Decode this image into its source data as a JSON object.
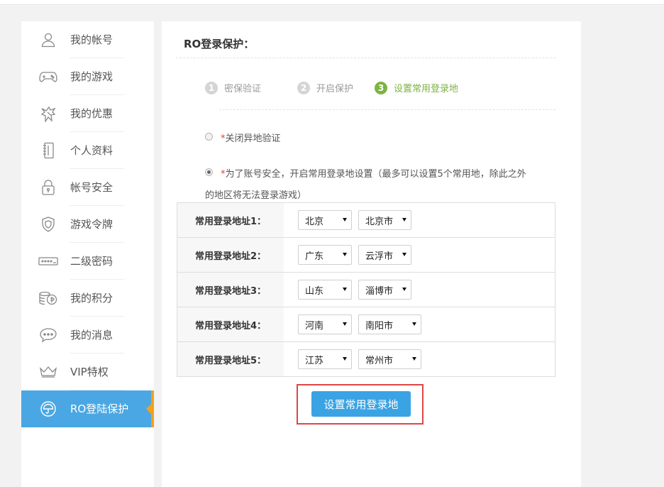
{
  "sidebar": {
    "items": [
      {
        "label": "我的帐号",
        "icon": "user-icon"
      },
      {
        "label": "我的游戏",
        "icon": "gamepad-icon"
      },
      {
        "label": "我的优惠",
        "icon": "gift-icon"
      },
      {
        "label": "个人资料",
        "icon": "notebook-icon"
      },
      {
        "label": "帐号安全",
        "icon": "lock-icon"
      },
      {
        "label": "游戏令牌",
        "icon": "shield-icon"
      },
      {
        "label": "二级密码",
        "icon": "password-icon"
      },
      {
        "label": "我的积分",
        "icon": "coins-icon"
      },
      {
        "label": "我的消息",
        "icon": "message-icon"
      },
      {
        "label": "VIP特权",
        "icon": "crown-icon"
      },
      {
        "label": "RO登陆保护",
        "icon": "umbrella-icon",
        "active": true
      }
    ]
  },
  "main": {
    "title": "RO登录保护：",
    "steps": [
      {
        "num": "1",
        "label": "密保验证"
      },
      {
        "num": "2",
        "label": "开启保护"
      },
      {
        "num": "3",
        "label": "设置常用登录地",
        "current": true
      }
    ],
    "options": {
      "off": {
        "star": "*",
        "label": "关闭异地验证",
        "checked": false
      },
      "on": {
        "star": "*",
        "line1": "为了账号安全，开启常用登录地设置（最多可以设置5个常用地，除此之外",
        "line2": "的地区将无法登录游戏）",
        "checked": true
      }
    },
    "locations": [
      {
        "label": "常用登录地址1：",
        "province": "北京",
        "city": "北京市"
      },
      {
        "label": "常用登录地址2：",
        "province": "广东",
        "city": "云浮市"
      },
      {
        "label": "常用登录地址3：",
        "province": "山东",
        "city": "淄博市"
      },
      {
        "label": "常用登录地址4：",
        "province": "河南",
        "city": "南阳市"
      },
      {
        "label": "常用登录地址5：",
        "province": "江苏",
        "city": "常州市"
      }
    ],
    "submit_label": "设置常用登录地"
  },
  "colors": {
    "accent": "#3aa3e3",
    "active_bg": "#4aa7e3",
    "active_marker": "#f2a01e",
    "step_current": "#7cb342",
    "highlight": "#e04545"
  }
}
